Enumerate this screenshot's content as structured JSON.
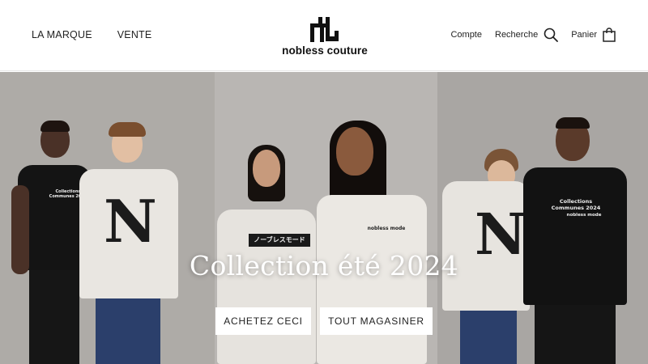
{
  "header": {
    "nav_left": [
      "LA MARQUE",
      "VENTE"
    ],
    "brand_name": "nobless couture",
    "account_label": "Compte",
    "search_label": "Recherche",
    "cart_label": "Panier",
    "icons": {
      "search": "search-icon",
      "cart": "shopping-bag-icon",
      "logo": "logo-mark"
    }
  },
  "hero": {
    "title": "Collection été 2024",
    "buttons": [
      "ACHETEZ CECI",
      "TOUT MAGASINER"
    ],
    "shirt_prints": {
      "n_letter": "N",
      "katakana": "ノーブレスモード",
      "collection_text": "Collections Communes 2024",
      "mode_text": "nobless mode"
    }
  },
  "colors": {
    "text": "#222222",
    "button_bg": "#ffffff",
    "hero_title": "#ffffff"
  }
}
